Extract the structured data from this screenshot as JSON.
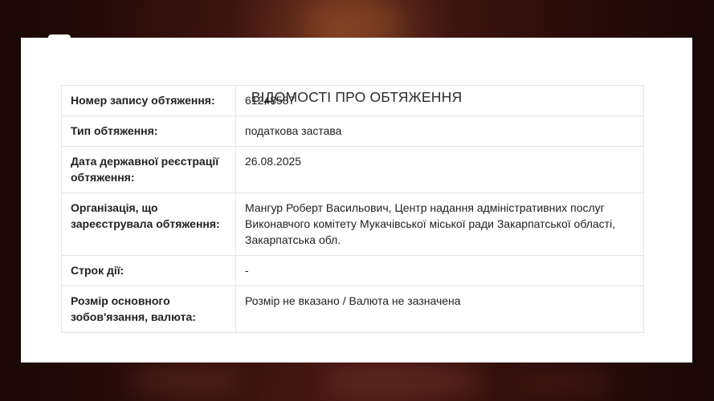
{
  "title": "ВІДОМОСТІ ПРО ОБТЯЖЕННЯ",
  "rows": [
    {
      "label": "Номер запису обтяження:",
      "value": "61248587"
    },
    {
      "label": "Тип обтяження:",
      "value": "податкова застава"
    },
    {
      "label": "Дата державної реєстрації обтяження:",
      "value": "26.08.2025"
    },
    {
      "label": "Організація, що зареєструвала обтяження:",
      "value": "Мангур Роберт Васильович, Центр надання адміністративних послуг Виконавчого комітету Мукачівської міської ради Закарпатської області, Закарпатська обл."
    },
    {
      "label": "Строк дії:",
      "value": "-"
    },
    {
      "label": "Розмір основного зобов'язання, валюта:",
      "value": "Розмір не вказано / Валюта не зазначена"
    }
  ],
  "colors": {
    "card_background": "#ffffff",
    "border": "#e4e4e4",
    "text": "#222222",
    "page_background": "#2a0c0a"
  }
}
